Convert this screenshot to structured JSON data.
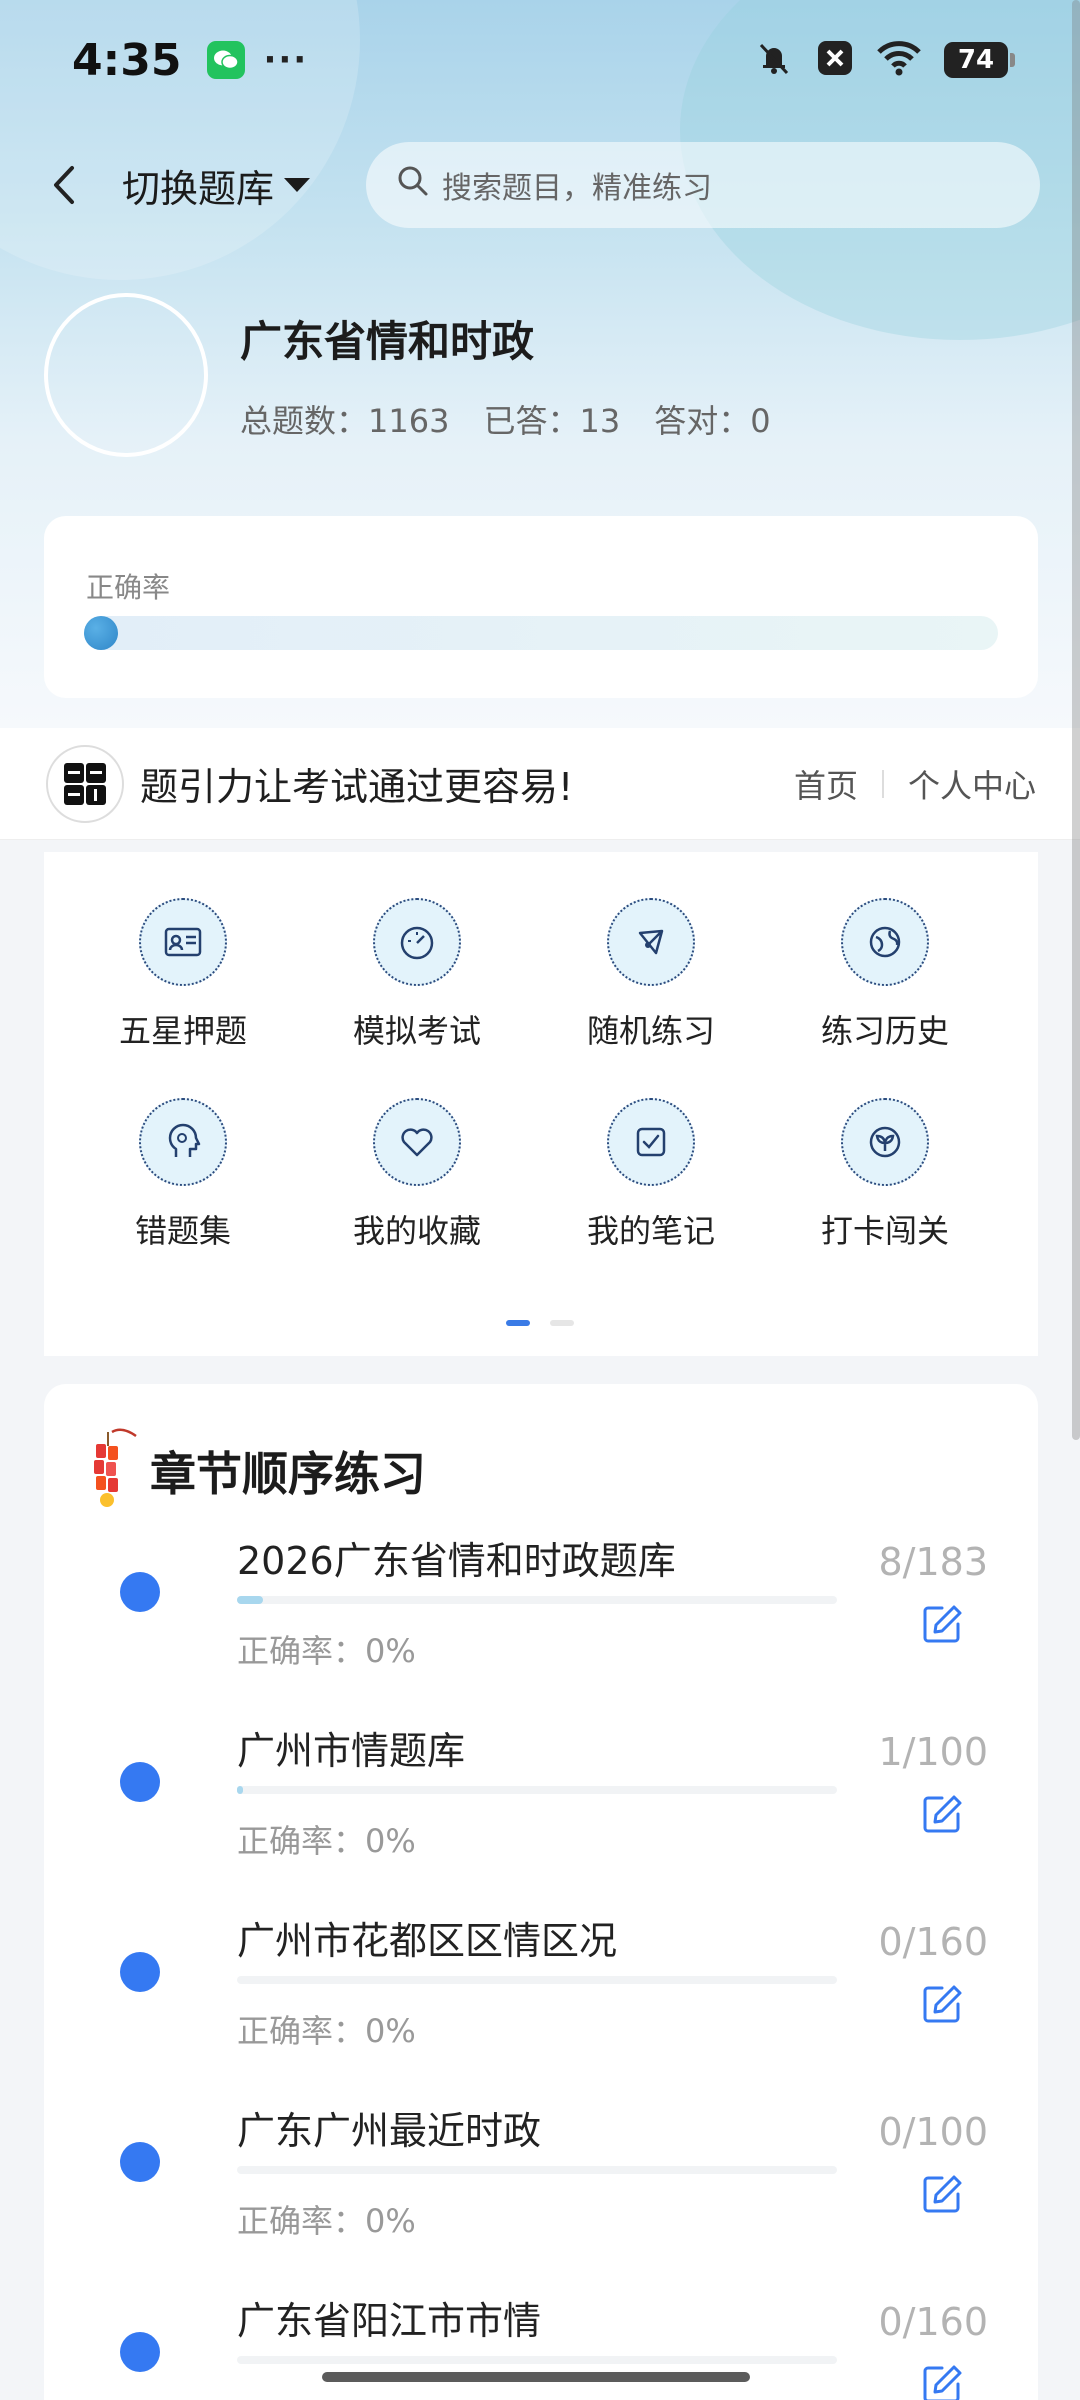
{
  "status_bar": {
    "time": "4:35",
    "more": "···",
    "battery": "74"
  },
  "nav": {
    "switch_label": "切换题库",
    "search_placeholder": "搜索题目，精准练习"
  },
  "bank": {
    "title": "广东省情和时政",
    "total_label": "总题数：1163",
    "answered_label": "已答：13",
    "correct_label": "答对：0",
    "accuracy_label": "正确率",
    "accuracy_fraction": 0.0
  },
  "banner": {
    "slogan": "题引力让考试通过更容易!",
    "link_home": "首页",
    "link_profile": "个人中心"
  },
  "features": [
    {
      "label": "五星押题",
      "icon": "id-card-icon"
    },
    {
      "label": "模拟考试",
      "icon": "gauge-icon"
    },
    {
      "label": "随机练习",
      "icon": "network-icon"
    },
    {
      "label": "练习历史",
      "icon": "globe-icon"
    },
    {
      "label": "错题集",
      "icon": "head-icon"
    },
    {
      "label": "我的收藏",
      "icon": "heart-icon"
    },
    {
      "label": "我的笔记",
      "icon": "note-check-icon"
    },
    {
      "label": "打卡闯关",
      "icon": "sprout-icon"
    }
  ],
  "chapters": {
    "title": "章节顺序练习",
    "items": [
      {
        "name": "2026广东省情和时政题库",
        "accuracy": "正确率：0%",
        "count": "8/183",
        "progress": 0.044
      },
      {
        "name": "广州市情题库",
        "accuracy": "正确率：0%",
        "count": "1/100",
        "progress": 0.01
      },
      {
        "name": "广州市花都区区情区况",
        "accuracy": "正确率：0%",
        "count": "0/160",
        "progress": 0
      },
      {
        "name": "广东广州最近时政",
        "accuracy": "正确率：0%",
        "count": "0/100",
        "progress": 0
      },
      {
        "name": "广东省阳江市市情",
        "accuracy": "",
        "count": "0/160",
        "progress": 0
      }
    ]
  },
  "colors": {
    "accent": "#3579f2",
    "progress_fill": "#a8d7ee",
    "icon_bg": "#e3f3fb"
  }
}
